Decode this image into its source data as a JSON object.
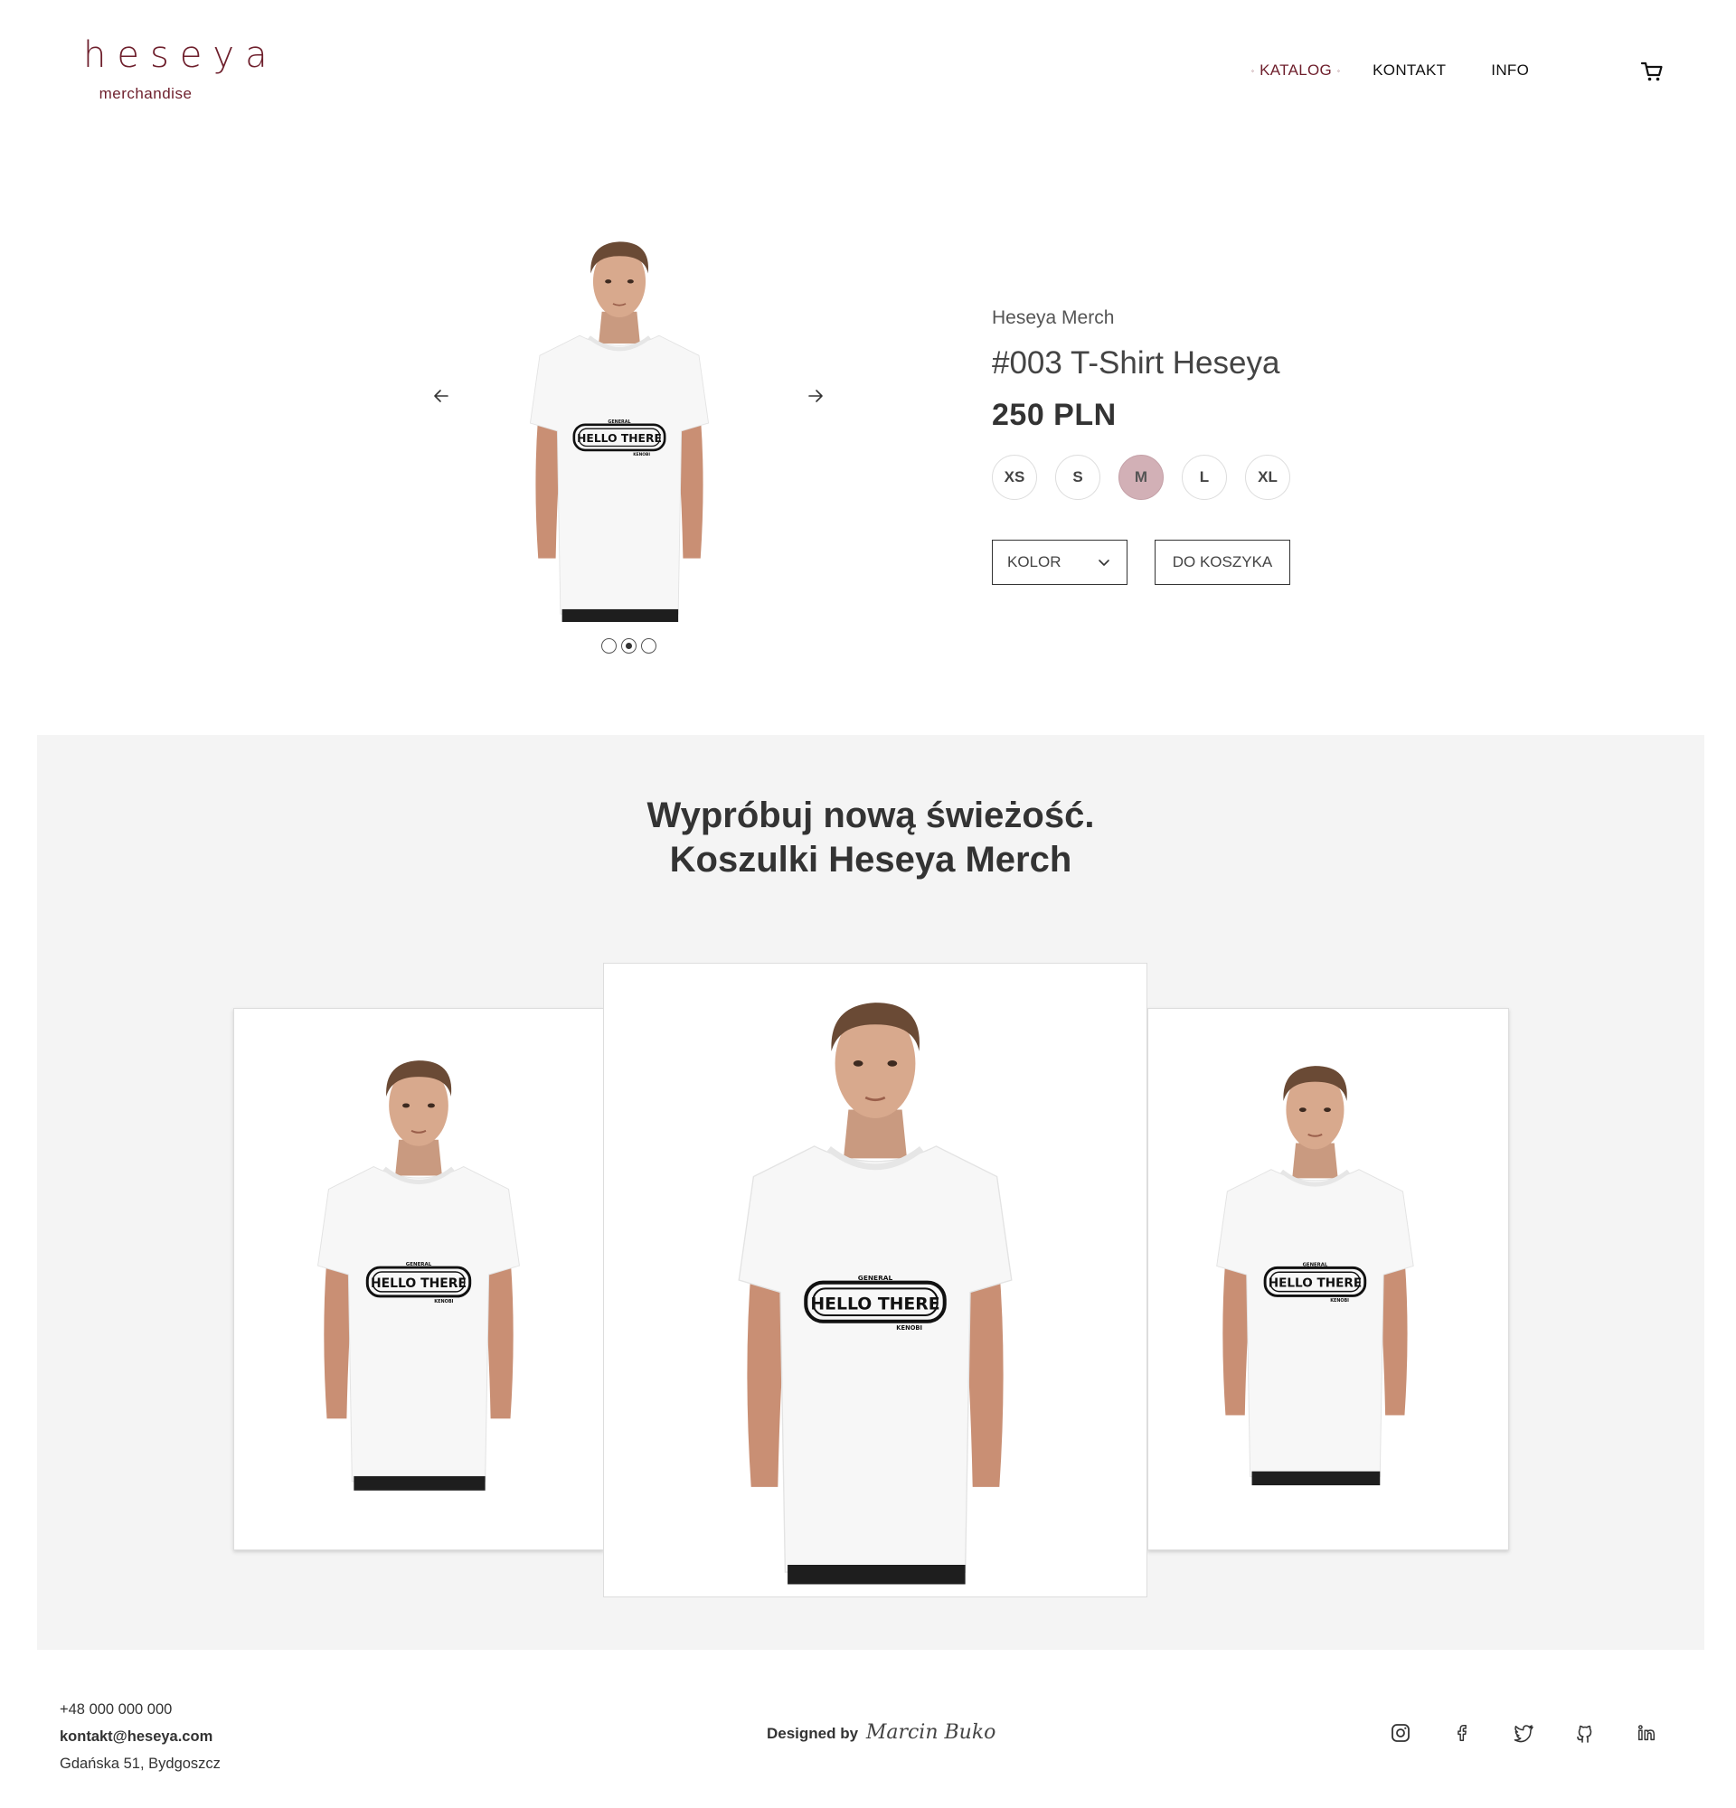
{
  "header": {
    "logo_text": "heseya",
    "logo_sub": "merchandise",
    "nav": [
      {
        "label": "KATALOG"
      },
      {
        "label": "KONTAKT"
      },
      {
        "label": "INFO"
      }
    ],
    "cart_icon": "cart-icon"
  },
  "product": {
    "brand": "Heseya Merch",
    "title": "#003 T-Shirt Heseya",
    "price": "250 PLN",
    "sizes": [
      "XS",
      "S",
      "M",
      "L",
      "XL"
    ],
    "selected_size": "M",
    "color_select_label": "KOLOR",
    "add_to_cart_label": "DO KOSZYKA",
    "gallery": {
      "slide_count": 3,
      "active_slide": 2,
      "print_text": {
        "top": "GENERAL",
        "main": "HELLO THERE",
        "bottom": "KENOBI"
      }
    }
  },
  "promo": {
    "title_line1": "Wypróbuj nową świeżość.",
    "title_line2": "Koszulki Heseya Merch"
  },
  "footer": {
    "phone": "+48 000 000 000",
    "email": "kontakt@heseya.com",
    "address": "Gdańska 51, Bydgoszcz",
    "designed_by": "Designed by",
    "designer": "Marcin Buko",
    "socials": [
      "instagram-icon",
      "facebook-icon",
      "twitter-icon",
      "github-icon",
      "linkedin-icon"
    ]
  },
  "colors": {
    "brand": "#6e1f2c",
    "size_selected_bg": "#d2b0b6",
    "promo_bg": "#f4f4f4"
  }
}
